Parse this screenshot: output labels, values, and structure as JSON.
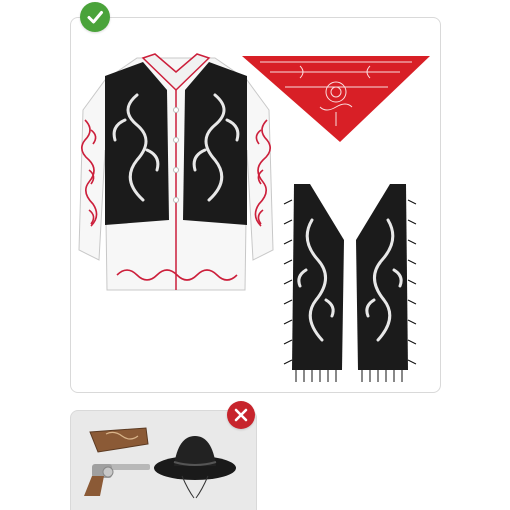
{
  "colors": {
    "included_badge": "#4aa33a",
    "excluded_badge": "#c7242c",
    "bandana": "#d81f26",
    "vest": "#1b1b1b",
    "shirt_trim": "#cc1f3b",
    "card_border": "#d9d9d9"
  },
  "included": {
    "badge_icon": "checkmark-icon",
    "items": [
      "shirt",
      "vest",
      "bandana",
      "chaps"
    ]
  },
  "excluded": {
    "badge_icon": "close-icon",
    "items": [
      "holster",
      "revolver",
      "hat"
    ]
  }
}
